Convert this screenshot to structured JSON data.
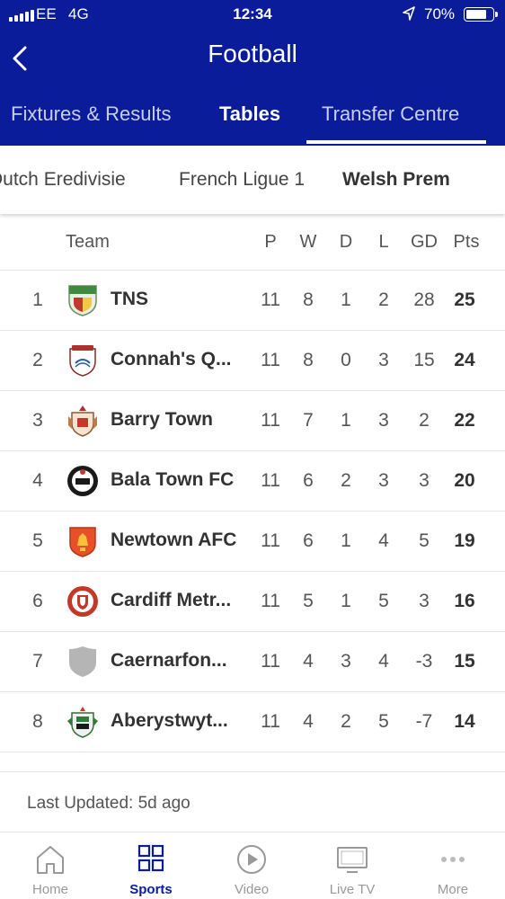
{
  "status_bar": {
    "carrier": "EE",
    "network": "4G",
    "time": "12:34",
    "battery": "70%"
  },
  "header": {
    "title": "Football",
    "tabs": [
      {
        "label": "Fixtures & Results"
      },
      {
        "label": "Tables",
        "active": true
      },
      {
        "label": "Transfer Centre"
      }
    ]
  },
  "leagues": [
    {
      "label": "Dutch Eredivisie"
    },
    {
      "label": "French Ligue 1"
    },
    {
      "label": "Welsh Prem",
      "active": true
    }
  ],
  "table": {
    "headers": {
      "team": "Team",
      "p": "P",
      "w": "W",
      "d": "D",
      "l": "L",
      "gd": "GD",
      "pts": "Pts"
    },
    "rows": [
      {
        "pos": "1",
        "team": "TNS",
        "p": "11",
        "w": "8",
        "d": "1",
        "l": "2",
        "gd": "28",
        "pts": "25",
        "crest": "tns-crest"
      },
      {
        "pos": "2",
        "team": "Connah's Q...",
        "p": "11",
        "w": "8",
        "d": "0",
        "l": "3",
        "gd": "15",
        "pts": "24",
        "crest": "connahs-quay-crest"
      },
      {
        "pos": "3",
        "team": "Barry Town",
        "p": "11",
        "w": "7",
        "d": "1",
        "l": "3",
        "gd": "2",
        "pts": "22",
        "crest": "barry-town-crest"
      },
      {
        "pos": "4",
        "team": "Bala Town FC",
        "p": "11",
        "w": "6",
        "d": "2",
        "l": "3",
        "gd": "3",
        "pts": "20",
        "crest": "bala-town-crest"
      },
      {
        "pos": "5",
        "team": "Newtown AFC",
        "p": "11",
        "w": "6",
        "d": "1",
        "l": "4",
        "gd": "5",
        "pts": "19",
        "crest": "newtown-crest"
      },
      {
        "pos": "6",
        "team": "Cardiff Metr...",
        "p": "11",
        "w": "5",
        "d": "1",
        "l": "5",
        "gd": "3",
        "pts": "16",
        "crest": "cardiff-met-crest"
      },
      {
        "pos": "7",
        "team": "Caernarfon...",
        "p": "11",
        "w": "4",
        "d": "3",
        "l": "4",
        "gd": "-3",
        "pts": "15",
        "crest": "generic-shield-crest"
      },
      {
        "pos": "8",
        "team": "Aberystwyt...",
        "p": "11",
        "w": "4",
        "d": "2",
        "l": "5",
        "gd": "-7",
        "pts": "14",
        "crest": "aberystwyth-crest"
      }
    ]
  },
  "last_updated": "Last Updated: 5d ago",
  "tabbar": [
    {
      "label": "Home",
      "icon": "home-icon"
    },
    {
      "label": "Sports",
      "icon": "grid-icon",
      "active": true
    },
    {
      "label": "Video",
      "icon": "play-icon"
    },
    {
      "label": "Live TV",
      "icon": "tv-icon"
    },
    {
      "label": "More",
      "icon": "more-icon"
    }
  ],
  "colors": {
    "brand": "#0b1c9b",
    "header_text": "#ffffff",
    "inactive_tab": "#999999"
  }
}
